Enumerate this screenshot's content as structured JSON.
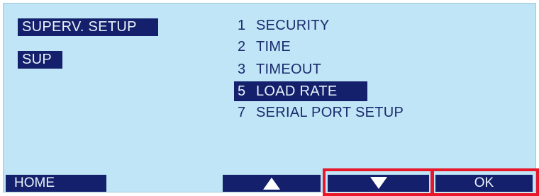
{
  "header": {
    "title": "SUPERV. SETUP",
    "mode": "SUP"
  },
  "menu": {
    "items": [
      {
        "number": "1",
        "label": "SECURITY",
        "selected": false
      },
      {
        "number": "2",
        "label": "TIME",
        "selected": false
      },
      {
        "number": "3",
        "label": "TIMEOUT",
        "selected": false
      },
      {
        "number": "5",
        "label": "LOAD RATE",
        "selected": true
      },
      {
        "number": "7",
        "label": "SERIAL PORT SETUP",
        "selected": false
      }
    ]
  },
  "softkeys": {
    "home_label": "HOME",
    "up_icon": "up-triangle-icon",
    "down_icon": "down-triangle-icon",
    "ok_label": "OK"
  },
  "colors": {
    "screen_background": "#bfe5f7",
    "inverse_background": "#14206b",
    "text": "#1b2a6d",
    "highlight_outline": "#e8182a"
  }
}
